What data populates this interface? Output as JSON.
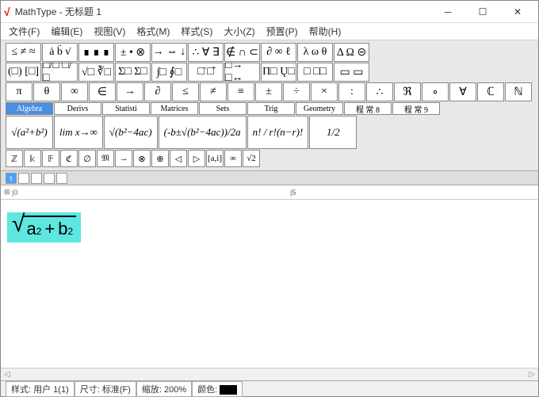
{
  "title": "MathType - 无标题 1",
  "menus": [
    "文件(F)",
    "编辑(E)",
    "视图(V)",
    "格式(M)",
    "样式(S)",
    "大小(Z)",
    "预置(P)",
    "帮助(H)"
  ],
  "palette": {
    "row1": [
      "≤ ≠ ≈",
      "ȧ b̈ ν̇",
      "∎ ∎ ∎",
      "± • ⊗",
      "→ ⇔ ↓",
      "∴ ∀ ∃",
      "∉ ∩ ⊂",
      "∂ ∞ ℓ",
      "λ ω θ",
      "Δ Ω ⊝"
    ],
    "row2": [
      "(□) [□]",
      "□/□ □/□",
      "√□ ∛□",
      "Σ□ Σ□",
      "∫□ ∮□",
      "□̄ □̂",
      "□→ □↔",
      "Π□ Ų□",
      "□ □□",
      "▭ ▭"
    ],
    "row3": [
      "π",
      "θ",
      "∞",
      "∈",
      "→",
      "∂",
      "≤",
      "≠",
      "≡",
      "±",
      "÷",
      "×",
      ":",
      "∴",
      "ℜ",
      "∘",
      "∀",
      "ℂ",
      "ℕ"
    ],
    "tabs": [
      "Algebra",
      "Derivs",
      "Statisti",
      "Matrices",
      "Sets",
      "Trig",
      "Geometry",
      "程 常 8",
      "程 常 9"
    ],
    "templates": [
      "√(a²+b²)",
      "lim x→∞",
      "√(b²−4ac)",
      "(-b±√(b²−4ac))/2a",
      "n! / r!(n−r)!",
      "1/2"
    ],
    "row_bottom": [
      "ℤ",
      "𝕜",
      "𝔽",
      "ℭ",
      "∅",
      "𝔐",
      "→",
      "⊗",
      "⊕",
      "◁",
      "▷",
      "[a,i]",
      "∞",
      "√2"
    ]
  },
  "tabs_below": {
    "count": 5,
    "active": 0,
    "labels": [
      "t",
      "",
      "",
      "",
      ""
    ]
  },
  "formula": {
    "latex": "\\sqrt{a^2+b^2}",
    "a": "a",
    "b": "b",
    "plus": "+",
    "sup": "2"
  },
  "status": {
    "style_label": "样式:",
    "style_value": "用户 1(1)",
    "size_label": "尺寸:",
    "size_value": "标准(F)",
    "zoom_label": "缩放:",
    "zoom_value": "200%",
    "color_label": "颜色:"
  }
}
